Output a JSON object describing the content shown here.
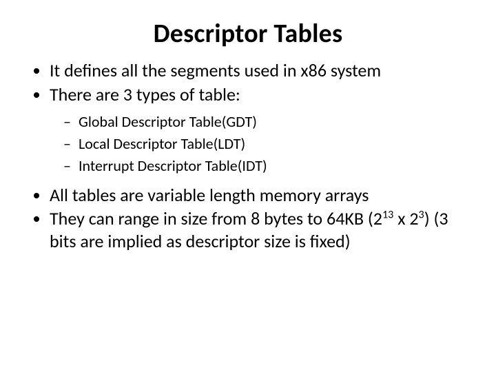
{
  "title": "Descriptor Tables",
  "bullets": {
    "b1": "It defines all the segments used in x86 system",
    "b2": "There are  3 types of table:",
    "sub1": "Global Descriptor Table(GDT)",
    "sub2": "Local Descriptor Table(LDT)",
    "sub3": "Interrupt Descriptor Table(IDT)",
    "b3": "All tables are variable length memory arrays",
    "b4_pre": "They can range in size from 8 bytes to 64KB (2",
    "b4_exp1": "13",
    "b4_mid": " x 2",
    "b4_exp2": "3",
    "b4_post": ") (3 bits are implied as descriptor size is fixed)"
  }
}
